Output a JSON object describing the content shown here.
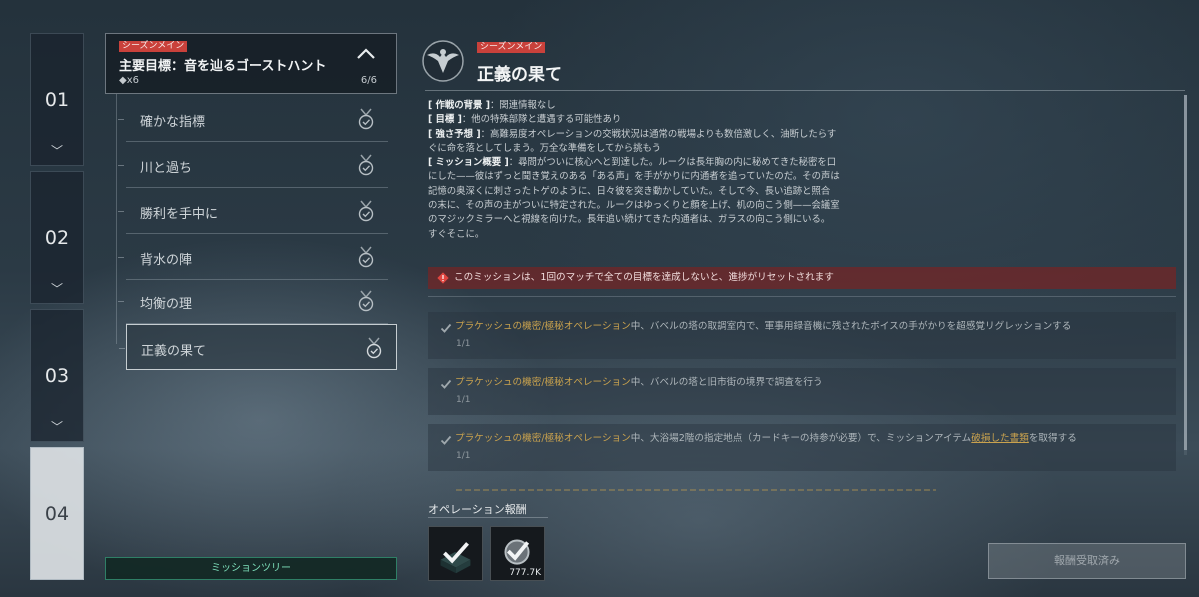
{
  "chapters": [
    {
      "label": "01"
    },
    {
      "label": "02"
    },
    {
      "label": "03"
    },
    {
      "label": "04"
    }
  ],
  "mission": {
    "tag": "シーズンメイン",
    "title": "主要目標：音を辿るゴーストハント",
    "count": "◆x6",
    "progress": "6/6"
  },
  "submissions": [
    {
      "label": "確かな指標"
    },
    {
      "label": "川と過ち"
    },
    {
      "label": "勝利を手中に"
    },
    {
      "label": "背水の陣"
    },
    {
      "label": "均衡の理"
    },
    {
      "label": "正義の果て"
    }
  ],
  "mission_tree_button": "ミッションツリー",
  "detail": {
    "tag": "シーズンメイン",
    "title": "正義の果て",
    "lines": [
      {
        "key": "[ 作戦の背景 ]",
        "text": "：関連情報なし"
      },
      {
        "key": "[ 目標 ]",
        "text": "：他の特殊部隊と遭遇する可能性あり"
      },
      {
        "key": "[ 強さ予想 ]",
        "text": "：高難易度オペレーションの交戦状況は通常の戦場よりも数倍激しく、油断したらす"
      },
      {
        "key": "",
        "text": "ぐに命を落としてしまう。万全な準備をしてから挑もう"
      },
      {
        "key": "[ ミッション概要 ]",
        "text": "：尋問がついに核心へと到達した。ルークは長年胸の内に秘めてきた秘密を口"
      },
      {
        "key": "",
        "text": "にした——彼はずっと聞き覚えのある「ある声」を手がかりに内通者を追っていたのだ。その声は"
      },
      {
        "key": "",
        "text": "記憶の奥深くに刺さったトゲのように、日々彼を突き動かしていた。そして今、長い追跡と照合"
      },
      {
        "key": "",
        "text": "の末に、その声の主がついに特定された。ルークはゆっくりと顔を上げ、机の向こう側——会議室"
      },
      {
        "key": "",
        "text": "のマジックミラーへと視線を向けた。長年追い続けてきた内通者は、ガラスの向こう側にいる。"
      },
      {
        "key": "",
        "text": "すぐそこに。"
      }
    ],
    "warning": "このミッションは、1回のマッチで全ての目標を達成しないと、進捗がリセットされます",
    "objectives": [
      {
        "hl": "プラケッシュの機密/極秘オペレーション",
        "pre": "中、バベルの塔の取調室内で、軍事用録音機に残されたボイスの手がかりを超感覚リグレッションする",
        "link": "",
        "post": "",
        "progress": "1/1"
      },
      {
        "hl": "プラケッシュの機密/極秘オペレーション",
        "pre": "中、バベルの塔と旧市街の境界で調査を行う",
        "link": "",
        "post": "",
        "progress": "1/1"
      },
      {
        "hl": "プラケッシュの機密/極秘オペレーション",
        "pre": "中、大浴場2階の指定地点（カードキーの持参が必要）で、ミッションアイテム",
        "link": "破損した書類",
        "post": "を取得する",
        "progress": "1/1"
      }
    ]
  },
  "rewards": {
    "title": "オペレーション報酬",
    "items": [
      {
        "value": ""
      },
      {
        "value": "777.7K"
      }
    ],
    "claim_button": "報酬受取済み"
  }
}
